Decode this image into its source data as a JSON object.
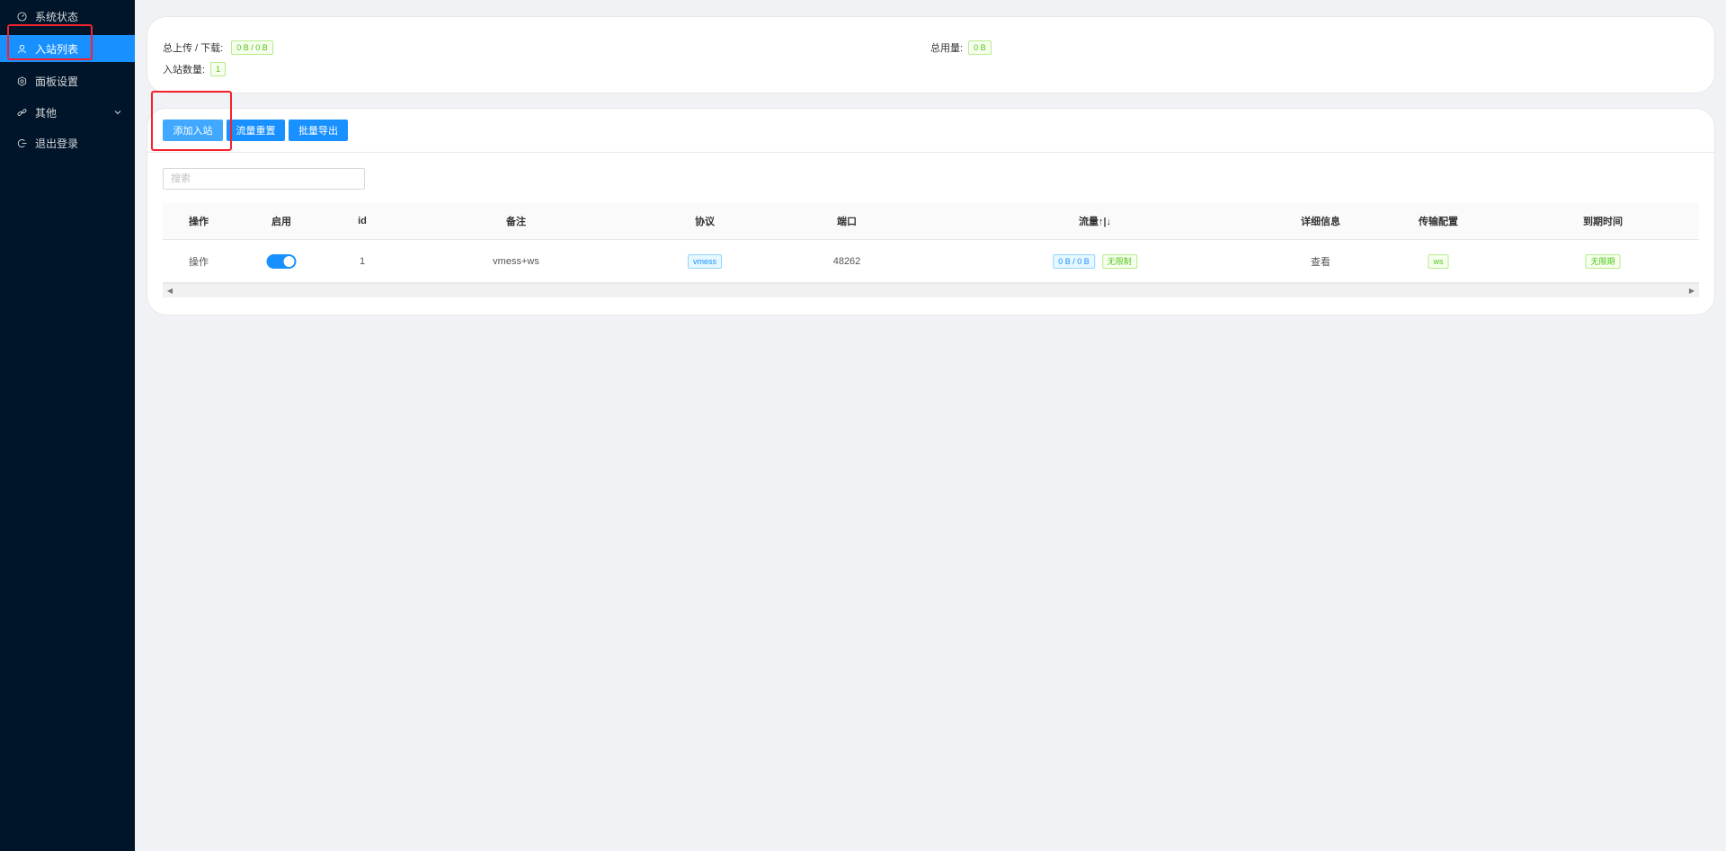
{
  "sidebar": {
    "items": [
      {
        "label": "系统状态",
        "icon": "dashboard-icon"
      },
      {
        "label": "入站列表",
        "icon": "user-icon",
        "active": true
      },
      {
        "label": "面板设置",
        "icon": "gear-icon"
      },
      {
        "label": "其他",
        "icon": "link-icon"
      },
      {
        "label": "退出登录",
        "icon": "logout-icon"
      }
    ]
  },
  "stats": {
    "upload_download_label": "总上传 / 下载:",
    "upload_download_value": "0 B / 0 B",
    "total_usage_label": "总用量:",
    "total_usage_value": "0 B",
    "inbound_count_label": "入站数量:",
    "inbound_count_value": "1"
  },
  "toolbar": {
    "add_label": "添加入站",
    "reset_label": "流量重置",
    "export_label": "批量导出"
  },
  "search": {
    "placeholder": "搜索"
  },
  "table": {
    "headers": {
      "action": "操作",
      "enable": "启用",
      "id": "id",
      "remark": "备注",
      "protocol": "协议",
      "port": "端口",
      "traffic": "流量↑|↓",
      "details": "详细信息",
      "transport": "传输配置",
      "expiry": "到期时间"
    },
    "rows": [
      {
        "action": "操作",
        "enabled": true,
        "id": "1",
        "remark": "vmess+ws",
        "protocol": "vmess",
        "port": "48262",
        "traffic": "0 B / 0 B",
        "traffic_limit": "无限制",
        "details": "查看",
        "transport": "ws",
        "expiry": "无限期"
      }
    ]
  },
  "colors": {
    "sidebar_bg": "#001529",
    "accent": "#1890ff",
    "highlight_box": "#f5222d",
    "tag_green": "#52c41a"
  }
}
